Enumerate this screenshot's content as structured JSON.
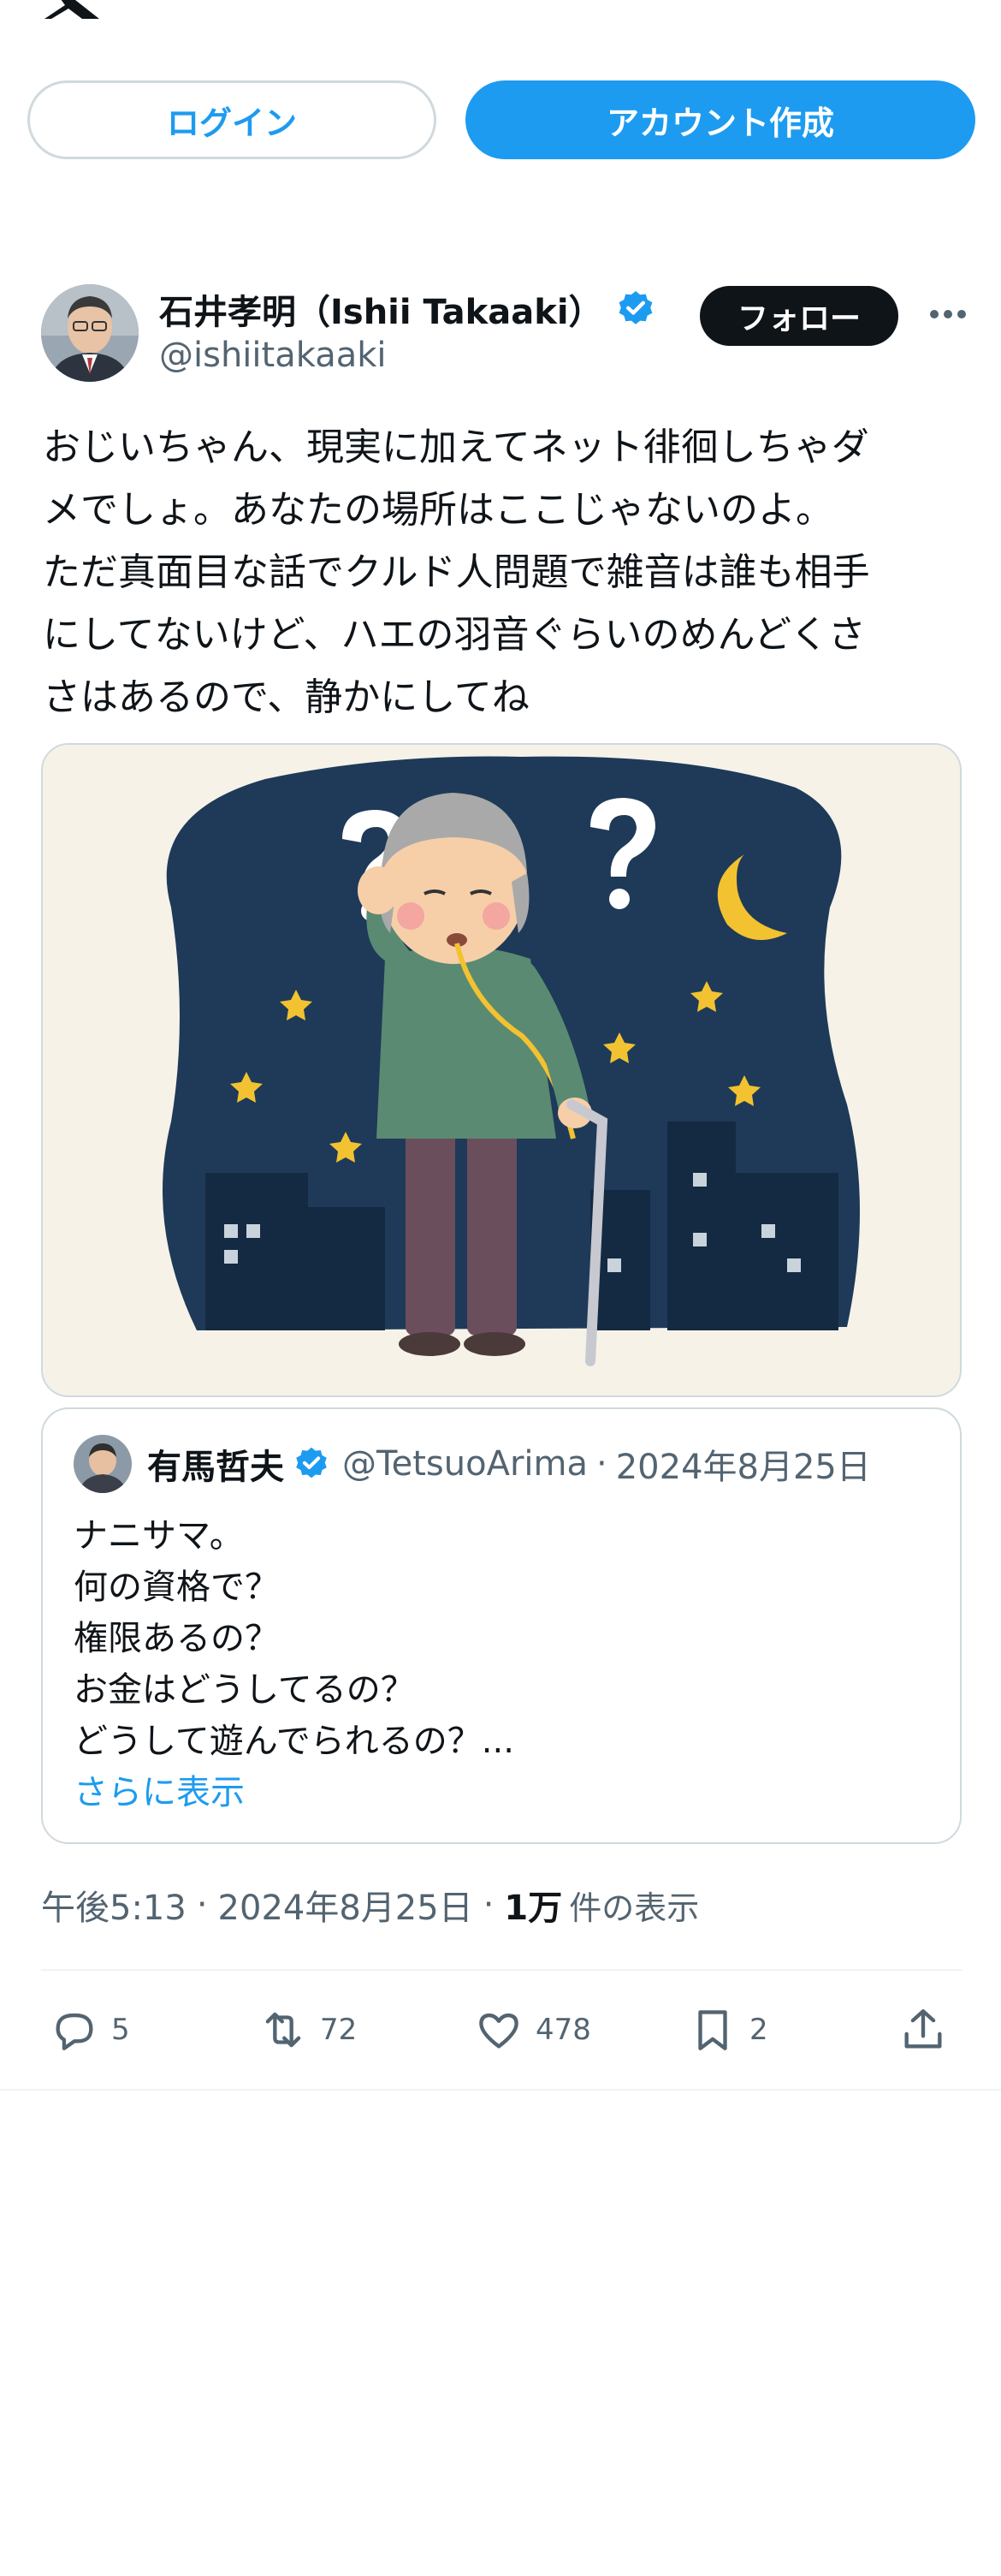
{
  "top_bar": {
    "logo_icon": "x-logo-icon"
  },
  "auth": {
    "login_label": "ログイン",
    "signup_label": "アカウント作成"
  },
  "tweet": {
    "display_name": "石井孝明（Ishii Takaaki）",
    "handle": "@ishiitakaaki",
    "follow_label": "フォロー",
    "text_lines": [
      "おじいちゃん、現実に加えてネット徘徊しちゃダ",
      "メでしょ。あなたの場所はここじゃないのよ。",
      "ただ真面目な話でクルド人問題で雑音は誰も相手",
      "にしてないけど、ハエの羽音ぐらいのめんどくさ",
      "さはあるので、静かにしてね"
    ],
    "time": "午後5:13",
    "date": "2024年8月25日",
    "views_count": "1万",
    "views_label": "件の表示",
    "separator": "·"
  },
  "quote": {
    "display_name": "有馬哲夫",
    "handle": "@TetsuoArima",
    "separator": "·",
    "date": "2024年8月25日",
    "lines": [
      "ナニサマ。",
      "何の資格で？",
      "権限あるの？",
      "お金はどうしてるの？",
      "どうして遊んでられるの？..."
    ],
    "show_more": "さらに表示"
  },
  "actions": {
    "replies": "5",
    "reposts": "72",
    "likes": "478",
    "bookmarks": "2"
  },
  "colors": {
    "accent": "#1d9bf0",
    "text": "#0f1419",
    "secondary": "#536471",
    "border": "#cfd9de"
  }
}
